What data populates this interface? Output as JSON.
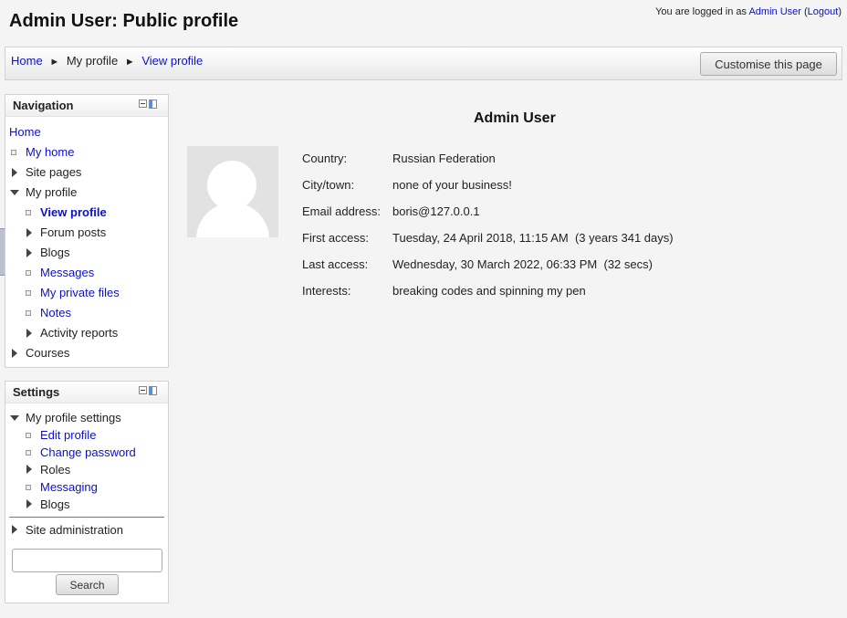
{
  "header": {
    "title": "Admin User: Public profile",
    "login_prefix": "You are logged in as",
    "login_user": "Admin User",
    "logout": "Logout"
  },
  "breadcrumb": {
    "home": "Home",
    "my_profile": "My profile",
    "view_profile": "View profile",
    "separator": "►"
  },
  "customise_button": "Customise this page",
  "navigation": {
    "title": "Navigation",
    "items": [
      {
        "label": "Home"
      },
      {
        "label": "My home"
      },
      {
        "label": "Site pages"
      },
      {
        "label": "My profile"
      },
      {
        "label": "View profile"
      },
      {
        "label": "Forum posts"
      },
      {
        "label": "Blogs"
      },
      {
        "label": "Messages"
      },
      {
        "label": "My private files"
      },
      {
        "label": "Notes"
      },
      {
        "label": "Activity reports"
      },
      {
        "label": "Courses"
      }
    ]
  },
  "settings": {
    "title": "Settings",
    "items": [
      {
        "label": "My profile settings"
      },
      {
        "label": "Edit profile"
      },
      {
        "label": "Change password"
      },
      {
        "label": "Roles"
      },
      {
        "label": "Messaging"
      },
      {
        "label": "Blogs"
      },
      {
        "label": "Site administration"
      }
    ],
    "search_value": "",
    "search_button": "Search"
  },
  "profile": {
    "name": "Admin User",
    "fields": [
      {
        "label": "Country:",
        "value": "Russian Federation"
      },
      {
        "label": "City/town:",
        "value": "none of your business!"
      },
      {
        "label": "Email address:",
        "value": "boris@127.0.0.1"
      },
      {
        "label": "First access:",
        "value": "Tuesday, 24 April 2018, 11:15 AM  (3 years 341 days)"
      },
      {
        "label": "Last access:",
        "value": "Wednesday, 30 March 2022, 06:33 PM  (32 secs)"
      },
      {
        "label": "Interests:",
        "value": "breaking codes and spinning my pen"
      }
    ]
  },
  "colors": {
    "link": "#0b10c9",
    "background": "#f4f4f4"
  }
}
